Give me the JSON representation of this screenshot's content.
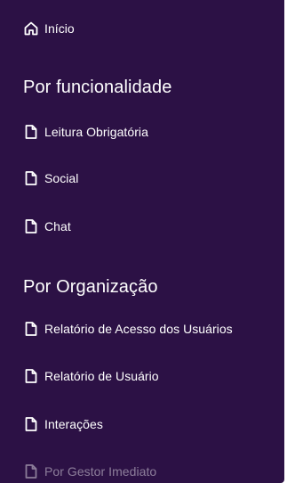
{
  "sidebar": {
    "home": {
      "label": "Início",
      "icon": "home-icon"
    },
    "sections": [
      {
        "title": "Por funcionalidade",
        "items": [
          {
            "label": "Leitura Obrigatória",
            "icon": "document-icon"
          },
          {
            "label": "Social",
            "icon": "document-icon"
          },
          {
            "label": "Chat",
            "icon": "document-icon"
          }
        ]
      },
      {
        "title": "Por Organização",
        "items": [
          {
            "label": "Relatório de Acesso dos Usuários",
            "icon": "document-icon"
          },
          {
            "label": "Relatório de Usuário",
            "icon": "document-icon"
          },
          {
            "label": "Interações",
            "icon": "document-icon"
          },
          {
            "label": "Por Gestor Imediato",
            "icon": "document-icon"
          }
        ]
      }
    ]
  },
  "colors": {
    "sidebar_background": "#2c1145",
    "text": "#ffffff"
  }
}
